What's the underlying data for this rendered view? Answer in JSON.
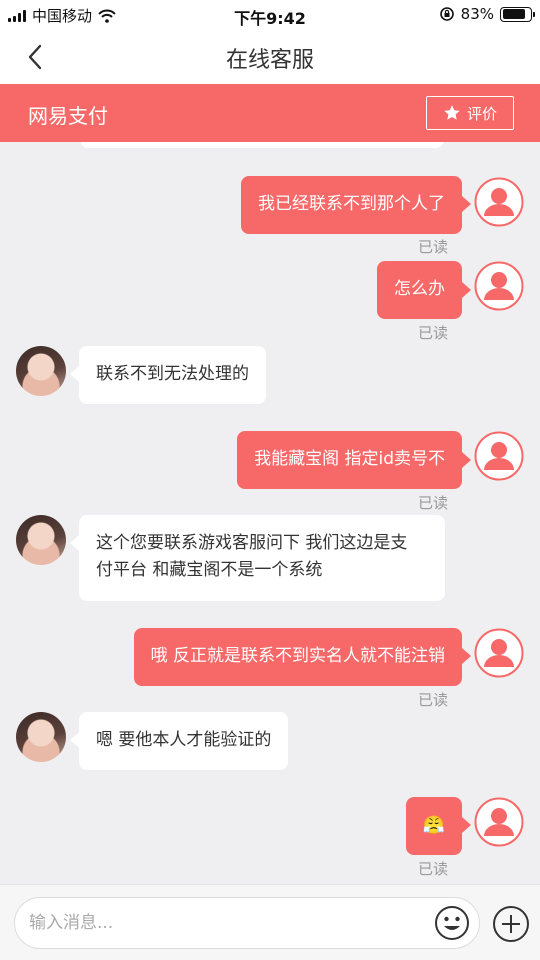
{
  "status_bar": {
    "carrier": "中国移动",
    "time": "下午9:42",
    "battery": "83%",
    "battery_level": 0.83
  },
  "nav": {
    "title": "在线客服",
    "back_icon": "chevron-left-icon"
  },
  "merchant": {
    "name": "网易支付",
    "rate_label": "评价",
    "rate_icon": "star-icon"
  },
  "messages": [
    {
      "from": "user",
      "text": "我已经联系不到那个人了",
      "status": "已读"
    },
    {
      "from": "user",
      "text": "怎么办",
      "status": "已读"
    },
    {
      "from": "agent",
      "text": "联系不到无法处理的"
    },
    {
      "from": "user",
      "text": "我能藏宝阁 指定id卖号不",
      "status": "已读"
    },
    {
      "from": "agent",
      "lines": [
        "这个您要联系游戏客服问下 我们这边是支",
        "付平台 和藏宝阁不是一个系统"
      ]
    },
    {
      "from": "user",
      "text": "哦 反正就是联系不到实名人就不能注销",
      "status": "已读"
    },
    {
      "from": "agent",
      "text": "嗯 要他本人才能验证的"
    },
    {
      "from": "user",
      "text": "😤",
      "status": "已读"
    }
  ],
  "input": {
    "placeholder": "输入消息...",
    "emoji_icon": "smiley-icon",
    "add_icon": "plus-circle-icon"
  },
  "colors": {
    "accent": "#f76868",
    "background": "#efeff1",
    "read_text": "#999999"
  }
}
